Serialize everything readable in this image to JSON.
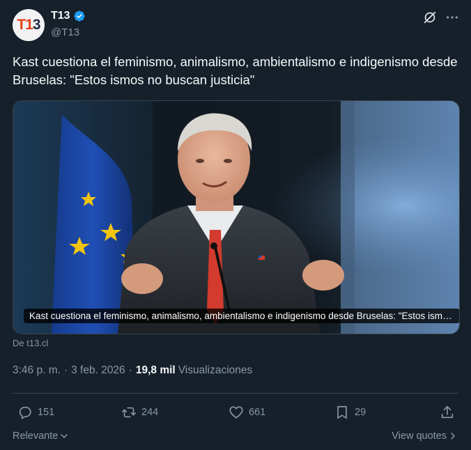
{
  "author": {
    "avatar_text_a": "T1",
    "avatar_text_b": "3",
    "display_name": "T13",
    "handle": "@T13",
    "verified": true
  },
  "header_icons": [
    "grok-icon",
    "more-icon"
  ],
  "tweet": {
    "text": "Kast cuestiona el feminismo, animalismo, ambientalismo e indigenismo desde Bruselas: \"Estos ismos no buscan justicia\""
  },
  "media": {
    "caption": "Kast cuestiona el feminismo, animalismo, ambientalismo e indigenismo desde Bruselas: \"Estos ismos no buscan justicia\"",
    "source": "De t13.cl"
  },
  "meta": {
    "time": "3:46 p. m.",
    "separator": "·",
    "date": "3 feb. 2026",
    "views_count": "19,8 mil",
    "views_label": "Visualizaciones"
  },
  "actions": {
    "replies": "151",
    "reposts": "244",
    "likes": "661",
    "bookmarks": "29"
  },
  "footer": {
    "sort_label": "Relevante",
    "view_quotes_label": "View quotes"
  },
  "colors": {
    "background": "#15202b",
    "text_primary": "#f7f9f9",
    "text_secondary": "#8b98a5",
    "border": "#38444d",
    "verified_blue": "#1d9bf0",
    "brand_red": "#e2401c"
  }
}
